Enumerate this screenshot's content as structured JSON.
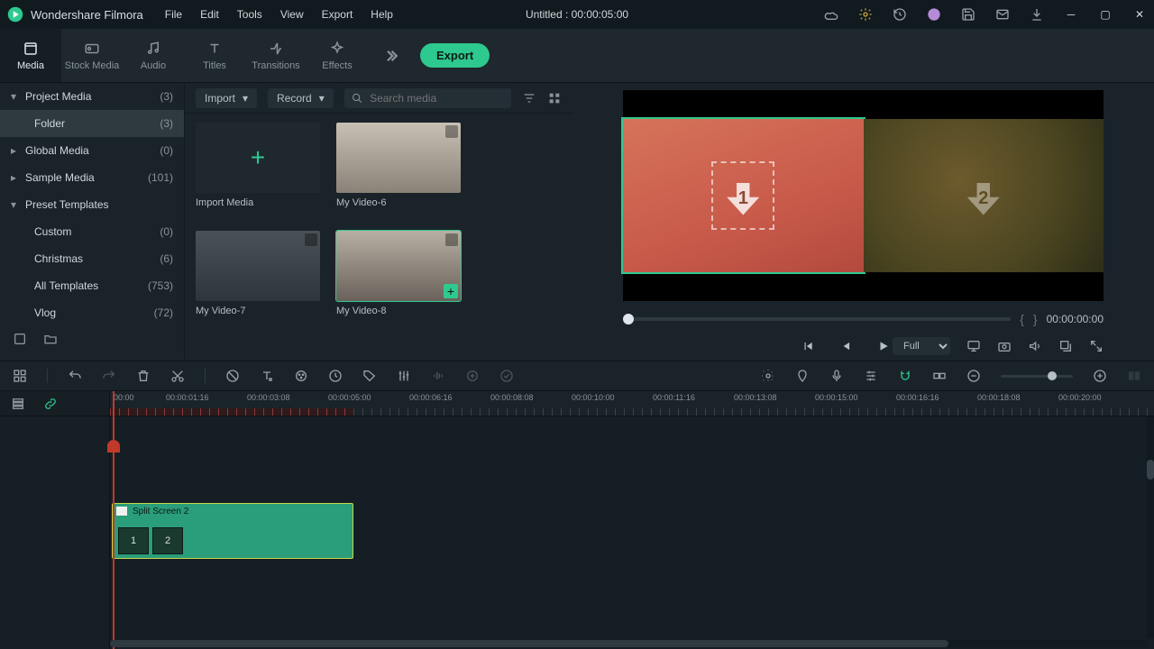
{
  "titlebar": {
    "app_name": "Wondershare Filmora",
    "menus": [
      "File",
      "Edit",
      "Tools",
      "View",
      "Export",
      "Help"
    ],
    "doc_title": "Untitled : 00:00:05:00"
  },
  "tabs": {
    "items": [
      "Media",
      "Stock Media",
      "Audio",
      "Titles",
      "Transitions",
      "Effects"
    ],
    "active": 0,
    "export_label": "Export"
  },
  "sidebar": {
    "items": [
      {
        "label": "Project Media",
        "count": "(3)",
        "caret": "down",
        "indent": 0
      },
      {
        "label": "Folder",
        "count": "(3)",
        "indent": 1,
        "selected": true
      },
      {
        "label": "Global Media",
        "count": "(0)",
        "caret": "right",
        "indent": 0
      },
      {
        "label": "Sample Media",
        "count": "(101)",
        "caret": "right",
        "indent": 0
      },
      {
        "label": "Preset Templates",
        "count": "",
        "caret": "down",
        "indent": 0
      },
      {
        "label": "Custom",
        "count": "(0)",
        "indent": 1
      },
      {
        "label": "Christmas",
        "count": "(6)",
        "indent": 1
      },
      {
        "label": "All Templates",
        "count": "(753)",
        "indent": 1
      },
      {
        "label": "Vlog",
        "count": "(72)",
        "indent": 1
      }
    ]
  },
  "mediapanel": {
    "import_label": "Import",
    "record_label": "Record",
    "search_placeholder": "Search media",
    "import_media_label": "Import Media",
    "clips": [
      {
        "label": "My Video-6"
      },
      {
        "label": "My Video-7"
      },
      {
        "label": "My Video-8",
        "selected": true,
        "add": true
      }
    ]
  },
  "preview": {
    "dropzones": [
      "1",
      "2"
    ],
    "brace_in": "{",
    "brace_out": "}",
    "timecode": "00:00:00:00",
    "quality": "Full"
  },
  "timeline": {
    "ticks": [
      "00:00",
      "00:00:01:16",
      "00:00:03:08",
      "00:00:05:00",
      "00:00:06:16",
      "00:00:08:08",
      "00:00:10:00",
      "00:00:11:16",
      "00:00:13:08",
      "00:00:15:00",
      "00:00:16:16",
      "00:00:18:08",
      "00:00:20:00"
    ],
    "clip": {
      "title": "Split Screen 2",
      "slots": [
        "1",
        "2"
      ]
    }
  }
}
